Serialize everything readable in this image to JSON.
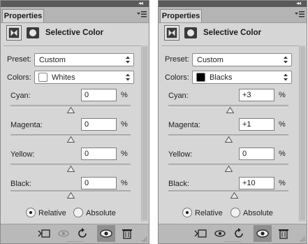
{
  "panels": [
    {
      "tab_label": "Properties",
      "heading": "Selective Color",
      "preset_label": "Preset:",
      "preset_value": "Custom",
      "colors_label": "Colors:",
      "colors_value": "Whites",
      "swatch_color": "#ffffff",
      "sliders": [
        {
          "label": "Cyan:",
          "value": "0",
          "unit": "%",
          "level": 0.5
        },
        {
          "label": "Magenta:",
          "value": "0",
          "unit": "%",
          "level": 0.5
        },
        {
          "label": "Yellow:",
          "value": "0",
          "unit": "%",
          "level": 0.5
        },
        {
          "label": "Black:",
          "value": "0",
          "unit": "%",
          "level": 0.5
        }
      ],
      "method": {
        "relative": "Relative",
        "absolute": "Absolute",
        "selected": "relative"
      }
    },
    {
      "tab_label": "Properties",
      "heading": "Selective Color",
      "preset_label": "Preset:",
      "preset_value": "Custom",
      "colors_label": "Colors:",
      "colors_value": "Blacks",
      "swatch_color": "#000000",
      "sliders": [
        {
          "label": "Cyan:",
          "value": "+3",
          "unit": "%",
          "level": 0.515
        },
        {
          "label": "Magenta:",
          "value": "+1",
          "unit": "%",
          "level": 0.505
        },
        {
          "label": "Yellow:",
          "value": "0",
          "unit": "%",
          "level": 0.5
        },
        {
          "label": "Black:",
          "value": "+10",
          "unit": "%",
          "level": 0.55
        }
      ],
      "method": {
        "relative": "Relative",
        "absolute": "Absolute",
        "selected": "relative"
      }
    }
  ],
  "bottom_icons": [
    "clip-to-layer-icon",
    "view-previous-state-icon",
    "reset-icon",
    "visibility-eye-icon",
    "trash-icon"
  ]
}
